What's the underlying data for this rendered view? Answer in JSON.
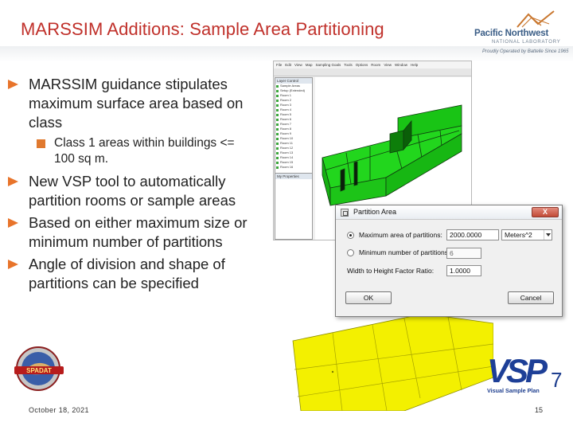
{
  "header": {
    "title": "MARSSIM Additions: Sample Area Partitioning",
    "logo_name": "Pacific Northwest",
    "logo_sub": "NATIONAL LABORATORY",
    "logo_tag": "Proudly Operated by Battelle Since 1965"
  },
  "bullets": [
    {
      "text": "MARSSIM guidance stipulates maximum surface area based on class",
      "level": 1
    },
    {
      "text": "Class 1 areas within buildings <= 100 sq m.",
      "level": 2
    },
    {
      "text": "New VSP tool to automatically partition rooms or sample areas",
      "level": 1
    },
    {
      "text": "Based on either maximum size or minimum number of partitions",
      "level": 1
    },
    {
      "text": "Angle of division and shape of partitions can be specified",
      "level": 1
    }
  ],
  "app_window": {
    "menu": [
      "File",
      "Edit",
      "View",
      "Map",
      "Sampling Goals",
      "Tools",
      "Options",
      "Room",
      "View",
      "Window",
      "Help"
    ],
    "tree_title": "Layer Control",
    "tree_items": [
      "Sample Areas",
      "Setup (Extended)",
      "Room 1",
      "Room 2",
      "Room 3",
      "Room 4",
      "Room 5",
      "Room 6",
      "Room 7",
      "Room 8",
      "Room 9",
      "Room 10",
      "Room 11",
      "Room 12",
      "Room 13",
      "Room 14",
      "Room 15",
      "Room 16"
    ],
    "props_title": "My Properties"
  },
  "dialog": {
    "title": "Partition Area",
    "close": "X",
    "max_area_label": "Maximum area of partitions:",
    "max_area_value": "2000.0000",
    "unit": "Meters^2",
    "min_number_label": "Minimum number of partitions:",
    "min_number_value": "6",
    "ratio_label": "Width to Height Factor Ratio:",
    "ratio_value": "1.0000",
    "ok": "OK",
    "cancel": "Cancel"
  },
  "footer": {
    "date": "October 18, 2021",
    "page": "15",
    "spadat_label": "SPADAT",
    "vsp_letters": "VSP",
    "vsp_seven": "7",
    "vsp_name": "Visual Sample Plan"
  },
  "colors": {
    "title": "#c0302a",
    "bullet_arrow": "#e8742b",
    "room_green": "#1fd21a",
    "floor_yellow": "#f3f000",
    "vsp_blue": "#1d3f97"
  }
}
